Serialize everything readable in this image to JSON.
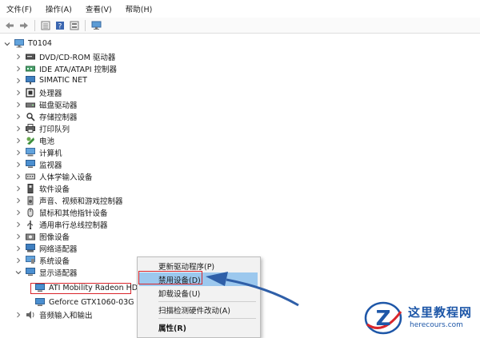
{
  "menubar": {
    "items": [
      "文件(F)",
      "操作(A)",
      "查看(V)",
      "帮助(H)"
    ]
  },
  "toolbar": {
    "buttons": [
      "back-icon",
      "forward-icon",
      "properties-icon",
      "help-icon",
      "list-icon",
      "monitor-icon"
    ]
  },
  "tree": {
    "root": "T0104",
    "items": [
      {
        "label": "DVD/CD-ROM 驱动器",
        "icon": "dvd-drive-icon"
      },
      {
        "label": "IDE ATA/ATAPI 控制器",
        "icon": "ide-controller-icon"
      },
      {
        "label": "SIMATIC NET",
        "icon": "network-device-icon"
      },
      {
        "label": "处理器",
        "icon": "processor-icon"
      },
      {
        "label": "磁盘驱动器",
        "icon": "disk-drive-icon"
      },
      {
        "label": "存储控制器",
        "icon": "storage-controller-icon"
      },
      {
        "label": "打印队列",
        "icon": "printer-icon"
      },
      {
        "label": "电池",
        "icon": "battery-icon"
      },
      {
        "label": "计算机",
        "icon": "computer-icon"
      },
      {
        "label": "监视器",
        "icon": "monitor-icon"
      },
      {
        "label": "人体学输入设备",
        "icon": "hid-icon"
      },
      {
        "label": "软件设备",
        "icon": "software-device-icon"
      },
      {
        "label": "声音、视频和游戏控制器",
        "icon": "audio-icon"
      },
      {
        "label": "鼠标和其他指针设备",
        "icon": "mouse-icon"
      },
      {
        "label": "通用串行总线控制器",
        "icon": "usb-icon"
      },
      {
        "label": "图像设备",
        "icon": "camera-icon"
      },
      {
        "label": "网络适配器",
        "icon": "network-adapter-icon"
      },
      {
        "label": "系统设备",
        "icon": "system-device-icon"
      },
      {
        "label": "显示适配器",
        "icon": "display-adapter-icon"
      }
    ],
    "children": [
      {
        "label": "ATI Mobility Radeon HD",
        "icon": "display-card-icon"
      },
      {
        "label": "Geforce GTX1060-03G Se",
        "icon": "display-card-icon"
      }
    ],
    "last": {
      "label": "音频输入和输出",
      "icon": "speaker-icon"
    }
  },
  "context_menu": {
    "items": [
      {
        "label": "更新驱动程序(P)"
      },
      {
        "label": "禁用设备(D)"
      },
      {
        "label": "卸载设备(U)"
      },
      {
        "label": "扫描检测硬件改动(A)"
      },
      {
        "label": "属性(R)"
      }
    ]
  },
  "watermark": {
    "title": "这里教程网",
    "url": "herecours.com"
  },
  "colors": {
    "highlight": "#9cc8ee",
    "annotation_red": "#d9252b",
    "arrow_blue": "#2f5fa8",
    "brand_blue": "#1e57a8"
  }
}
